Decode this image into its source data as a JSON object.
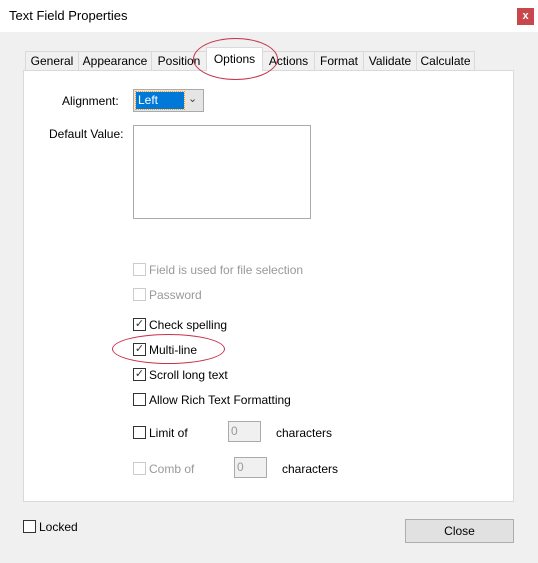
{
  "window": {
    "title": "Text Field Properties",
    "close_glyph": "x"
  },
  "tabs": [
    {
      "label": "General"
    },
    {
      "label": "Appearance"
    },
    {
      "label": "Position"
    },
    {
      "label": "Options",
      "active": true
    },
    {
      "label": "Actions"
    },
    {
      "label": "Format"
    },
    {
      "label": "Validate"
    },
    {
      "label": "Calculate"
    }
  ],
  "options": {
    "alignment_label": "Alignment:",
    "alignment_value": "Left",
    "default_value_label": "Default Value:",
    "default_value": "",
    "file_selection": {
      "label": "Field is used for file selection",
      "checked": false,
      "disabled": true
    },
    "password": {
      "label": "Password",
      "checked": false,
      "disabled": true
    },
    "check_spelling": {
      "label": "Check spelling",
      "checked": true
    },
    "multi_line": {
      "label": "Multi-line",
      "checked": true
    },
    "scroll_long_text": {
      "label": "Scroll long text",
      "checked": true
    },
    "rich_text": {
      "label": "Allow Rich Text Formatting",
      "checked": false
    },
    "limit_of": {
      "label": "Limit of",
      "value": "0",
      "suffix": "characters",
      "checked": false
    },
    "comb_of": {
      "label": "Comb of",
      "value": "0",
      "suffix": "characters",
      "checked": false,
      "disabled": true
    }
  },
  "footer": {
    "locked_label": "Locked",
    "locked_checked": false,
    "close_label": "Close"
  },
  "annotation_color": "#c8324a"
}
